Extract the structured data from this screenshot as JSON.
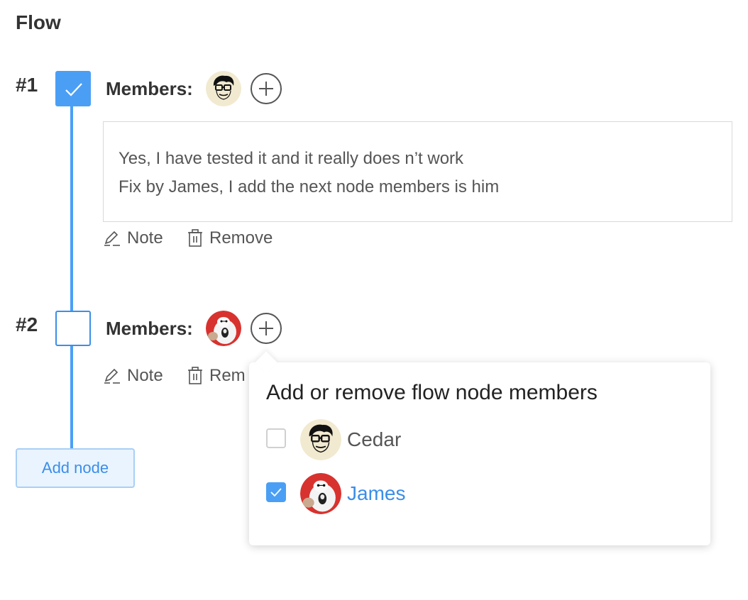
{
  "page": {
    "title": "Flow"
  },
  "nodes": [
    {
      "number": "#1",
      "members_label": "Members:",
      "checked": true,
      "member_avatars": [
        "cedar-avatar"
      ],
      "note_lines": [
        "Yes,  I have tested it and it really does n’t work",
        "Fix by James, I add the next node members is him"
      ],
      "actions": {
        "note": "Note",
        "remove": "Remove"
      }
    },
    {
      "number": "#2",
      "members_label": "Members:",
      "checked": false,
      "member_avatars": [
        "james-avatar"
      ],
      "actions": {
        "note": "Note",
        "remove": "Rem"
      }
    }
  ],
  "add_node_label": "Add node",
  "popover": {
    "title": "Add or remove flow node members",
    "options": [
      {
        "name": "Cedar",
        "checked": false
      },
      {
        "name": "James",
        "checked": true
      }
    ]
  },
  "colors": {
    "accent": "#4a9ff5",
    "text": "#333333",
    "muted": "#555555",
    "border": "#d9d9d9"
  },
  "icons": [
    "check-icon",
    "plus-circle-icon",
    "pencil-icon",
    "trash-icon"
  ]
}
